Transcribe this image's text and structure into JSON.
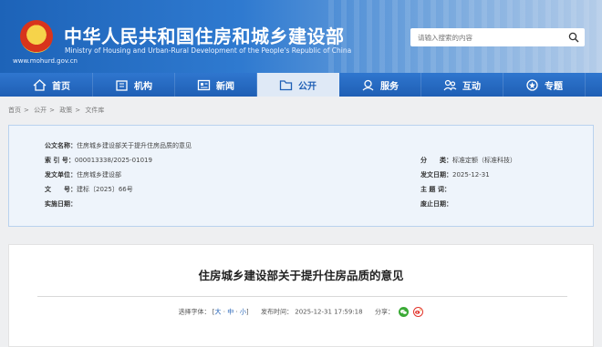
{
  "header": {
    "title_cn": "中华人民共和国住房和城乡建设部",
    "title_en": "Ministry of Housing and Urban-Rural Development of the People's Republic of China",
    "site_url": "www.mohurd.gov.cn",
    "search_placeholder": "请输入搜索的内容"
  },
  "nav": {
    "items": [
      {
        "label": "首页",
        "icon": "home-icon"
      },
      {
        "label": "机构",
        "icon": "building-icon"
      },
      {
        "label": "新闻",
        "icon": "news-icon"
      },
      {
        "label": "公开",
        "icon": "open-icon"
      },
      {
        "label": "服务",
        "icon": "service-icon"
      },
      {
        "label": "互动",
        "icon": "interact-icon"
      },
      {
        "label": "专题",
        "icon": "topic-icon"
      }
    ],
    "active_index": 3
  },
  "breadcrumb": [
    "首页",
    "公开",
    "政策",
    "文件库"
  ],
  "meta": {
    "title_label": "公文名称：",
    "title_value": "住房城乡建设部关于提升住房品质的意见",
    "index_label": "索 引 号：",
    "index_value": "000013338/2025-01019",
    "category_label": "分　　类：",
    "category_value": "标准定额（标准科技）",
    "issuer_label": "发文单位：",
    "issuer_value": "住房城乡建设部",
    "date_label": "发文日期：",
    "date_value": "2025-12-31",
    "docno_label": "文　　号：",
    "docno_value": "建标〔2025〕66号",
    "subject_label": "主 题 词：",
    "subject_value": "",
    "effective_label": "实施日期：",
    "effective_value": "",
    "expire_label": "废止日期：",
    "expire_value": ""
  },
  "article": {
    "title": "住房城乡建设部关于提升住房品质的意见",
    "font_label": "选择字体：",
    "font_sizes": [
      "大",
      "中",
      "小"
    ],
    "publish_label": "发布时间：",
    "publish_time": "2025-12-31 17:59:18",
    "share_label": "分享："
  },
  "colors": {
    "primary": "#1f5fb5",
    "meta_bg": "#eef4fb",
    "meta_border": "#b9d2ee"
  }
}
